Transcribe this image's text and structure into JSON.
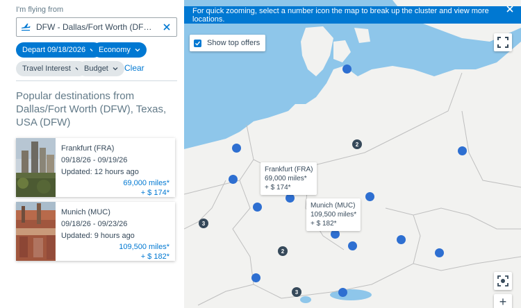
{
  "search": {
    "flying_label": "I'm flying from",
    "from_value": "DFW - Dallas/Fort Worth (DFW), Texas, U..."
  },
  "filters": {
    "depart": "Depart 09/18/2026",
    "cabin": "Economy",
    "travel_interest": "Travel Interest",
    "budget": "Budget",
    "clear": "Clear"
  },
  "popular": {
    "title": "Popular destinations from Dallas/Fort Worth (DFW), Texas, USA (DFW)",
    "cards": [
      {
        "name": "Frankfurt (FRA)",
        "dates": "09/18/26 - 09/19/26",
        "updated": "Updated: 12 hours ago",
        "miles": "69,000 miles*",
        "tax": "+ $ 174*"
      },
      {
        "name": "Munich (MUC)",
        "dates": "09/18/26 - 09/23/26",
        "updated": "Updated: 9 hours ago",
        "miles": "109,500 miles*",
        "tax": "+ $ 182*"
      }
    ]
  },
  "map": {
    "banner": "For quick zooming, select a number icon the map to break up the cluster and view more locations.",
    "show_top_offers": "Show top offers",
    "show_top_offers_checked": true,
    "clusters": [
      "2",
      "3",
      "2",
      "3"
    ],
    "popups": [
      {
        "name": "Frankfurt (FRA)",
        "miles": "69,000 miles*",
        "tax": "+ $ 174*"
      },
      {
        "name": "Munich (MUC)",
        "miles": "109,500 miles*",
        "tax": "+ $ 182*"
      }
    ],
    "zoom_in_label": "+"
  },
  "colors": {
    "accent": "#0078d2",
    "pin": "#2e6fd1",
    "water": "#8ec6ea",
    "land": "#f2f2f0"
  }
}
